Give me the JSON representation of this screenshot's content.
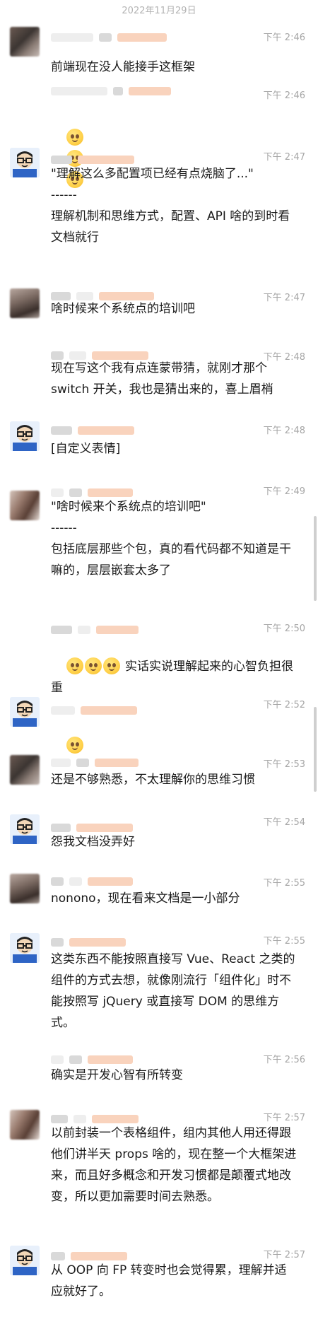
{
  "date_separator": "2022年11月29日",
  "messages": [
    {
      "time": "下午 2:46",
      "text": "前端现在没人能接手这框架",
      "avatar": "blur"
    },
    {
      "time": "下午 2:46",
      "text": "",
      "emojis": 3
    },
    {
      "time": "下午 2:47",
      "text": "\"理解这么多配置项已经有点烧脑了...\"\n------\n理解机制和思维方式，配置、API 啥的到时看文档就行",
      "avatar": "cartoon"
    },
    {
      "time": "下午 2:47",
      "text": "啥时候来个系统点的培训吧",
      "avatar": "blur"
    },
    {
      "time": "下午 2:48",
      "text": "现在写这个我有点连蒙带猜，就刚才那个 switch 开关，我也是猜出来的，喜上眉梢"
    },
    {
      "time": "下午 2:48",
      "text": "[自定义表情]",
      "avatar": "cartoon"
    },
    {
      "time": "下午 2:49",
      "text": "\"啥时候来个系统点的培训吧\"\n------\n包括底层那些个包，真的看代码都不知道是干嘛的，层层嵌套太多了",
      "avatar": "blur"
    },
    {
      "time": "下午 2:50",
      "text": "实话实说理解起来的心智负担很重",
      "emojis": 3
    },
    {
      "time": "下午 2:52",
      "text": "",
      "avatar": "cartoon",
      "emojis": 1
    },
    {
      "time": "下午 2:53",
      "text": "还是不够熟悉，不太理解你的思维习惯",
      "avatar": "blur"
    },
    {
      "time": "下午 2:54",
      "text": "怨我文档没弄好",
      "avatar": "cartoon"
    },
    {
      "time": "下午 2:55",
      "text": "nonono，现在看来文档是一小部分",
      "avatar": "blur"
    },
    {
      "time": "下午 2:55",
      "text": "这类东西不能按照直接写 Vue、React 之类的组件的方式去想，就像刚流行「组件化」时不能按照写 jQuery 或直接写 DOM 的思维方式。",
      "avatar": "cartoon"
    },
    {
      "time": "下午 2:56",
      "text": "确实是开发心智有所转变"
    },
    {
      "time": "下午 2:57",
      "text": "以前封装一个表格组件，组内其他人用还得跟他们讲半天 props 啥的，现在整一个大框架进来，而且好多概念和开发习惯都是颠覆式地改变，所以更加需要时间去熟悉。",
      "avatar": "blur"
    },
    {
      "time": "下午 2:57",
      "text": "从 OOP 向 FP 转变时也会觉得累，理解并适应就好了。",
      "avatar": "cartoon"
    }
  ]
}
